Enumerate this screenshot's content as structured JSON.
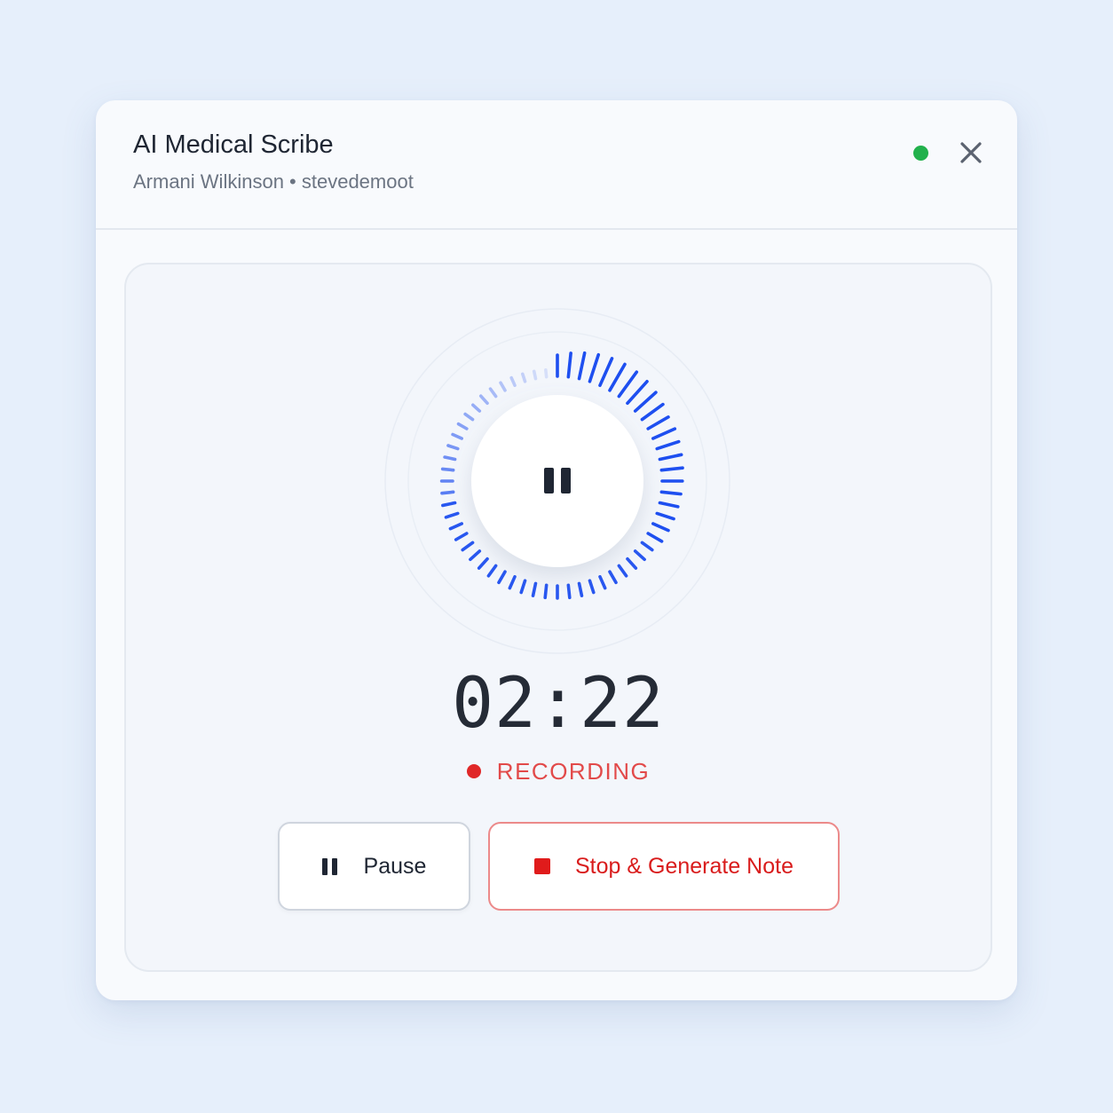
{
  "dialog": {
    "title": "AI Medical Scribe",
    "subtitle": "Armani Wilkinson • stevedemoot",
    "status_color": "#22b14c",
    "close_icon": "close-icon"
  },
  "recorder": {
    "timer": "02:22",
    "status_label": "RECORDING",
    "status_color": "#e02828",
    "accent_color": "#1e4ff0",
    "center_icon": "pause-icon"
  },
  "actions": {
    "pause_label": "Pause",
    "pause_icon": "pause-icon",
    "stop_label": "Stop & Generate Note",
    "stop_icon": "stop-icon"
  }
}
